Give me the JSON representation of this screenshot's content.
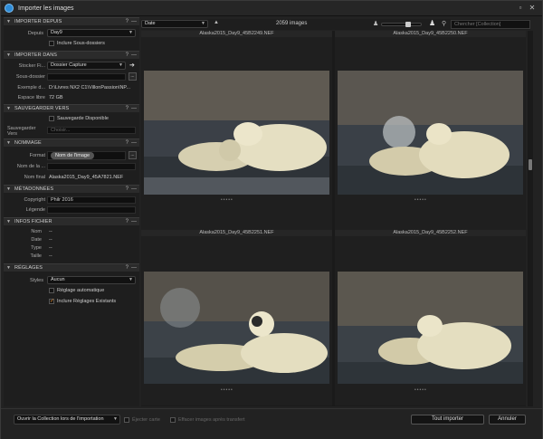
{
  "window": {
    "title": "Importer les images"
  },
  "sections": {
    "importer_depuis": {
      "title": "IMPORTER DEPUIS",
      "depuis_label": "Depuis",
      "depuis_value": "Day9",
      "include_subfolders": "Inclure Sous-dossiers"
    },
    "importer_dans": {
      "title": "IMPORTER DANS",
      "stocker_label": "Stocker Fi...",
      "stocker_value": "Dossier Capture",
      "sous_dossier_label": "Sous-dossier",
      "exemple_label": "Exemple d...",
      "exemple_value": "D:\\Livres NX2 C1\\VillonPassion\\NP...",
      "espace_label": "Espace libre",
      "espace_value": "72 GB"
    },
    "sauvegarder_vers": {
      "title": "SAUVEGARDER VERS",
      "backup_checkbox": "Sauvegarde Disponible",
      "save_to_label": "Sauvegarder Vers",
      "choose_placeholder": "Choisir..."
    },
    "nommage": {
      "title": "NOMMAGE",
      "format_label": "Format",
      "format_token": "Nom de l'image",
      "nom_job_label": "Nom de la ...",
      "nom_final_label": "Nom final",
      "nom_final_value": "Alaska2015_Day9_45A7821.NEF"
    },
    "metadonnees": {
      "title": "MÉTADONNÉES",
      "copyright_label": "Copyright",
      "copyright_value": "Philr 2016",
      "legende_label": "Légende"
    },
    "infos_fichier": {
      "title": "INFOS FICHIER",
      "rows": [
        {
          "label": "Nom",
          "value": "--"
        },
        {
          "label": "Date",
          "value": "--"
        },
        {
          "label": "Type",
          "value": "--"
        },
        {
          "label": "Taille",
          "value": "--"
        }
      ]
    },
    "reglages": {
      "title": "RÉGLAGES",
      "styles_label": "Styles",
      "styles_value": "Aucun",
      "auto_adjust": "Réglage automatique",
      "include_existing": "Inclure Réglages Existants"
    }
  },
  "toolbar": {
    "sort_value": "Date",
    "image_count": "2059 images",
    "search_placeholder": "Chercher [Collection]"
  },
  "thumbnails": [
    {
      "name": "Alaska2015_Day9_45B2249.NEF"
    },
    {
      "name": "Alaska2015_Day9_45B2250.NEF"
    },
    {
      "name": "Alaska2015_Day9_45B2251.NEF"
    },
    {
      "name": "Alaska2015_Day9_45B2252.NEF"
    }
  ],
  "bottom": {
    "open_collection": "Ouvrir la Collection lors de l'importation",
    "eject_card": "Éjecter carte",
    "delete_after": "Effacer images après transfert",
    "import_all": "Tout importer",
    "cancel": "Annuler"
  },
  "colors": {
    "accent": "#e08a2a",
    "app_icon": "#2e8bd6"
  }
}
